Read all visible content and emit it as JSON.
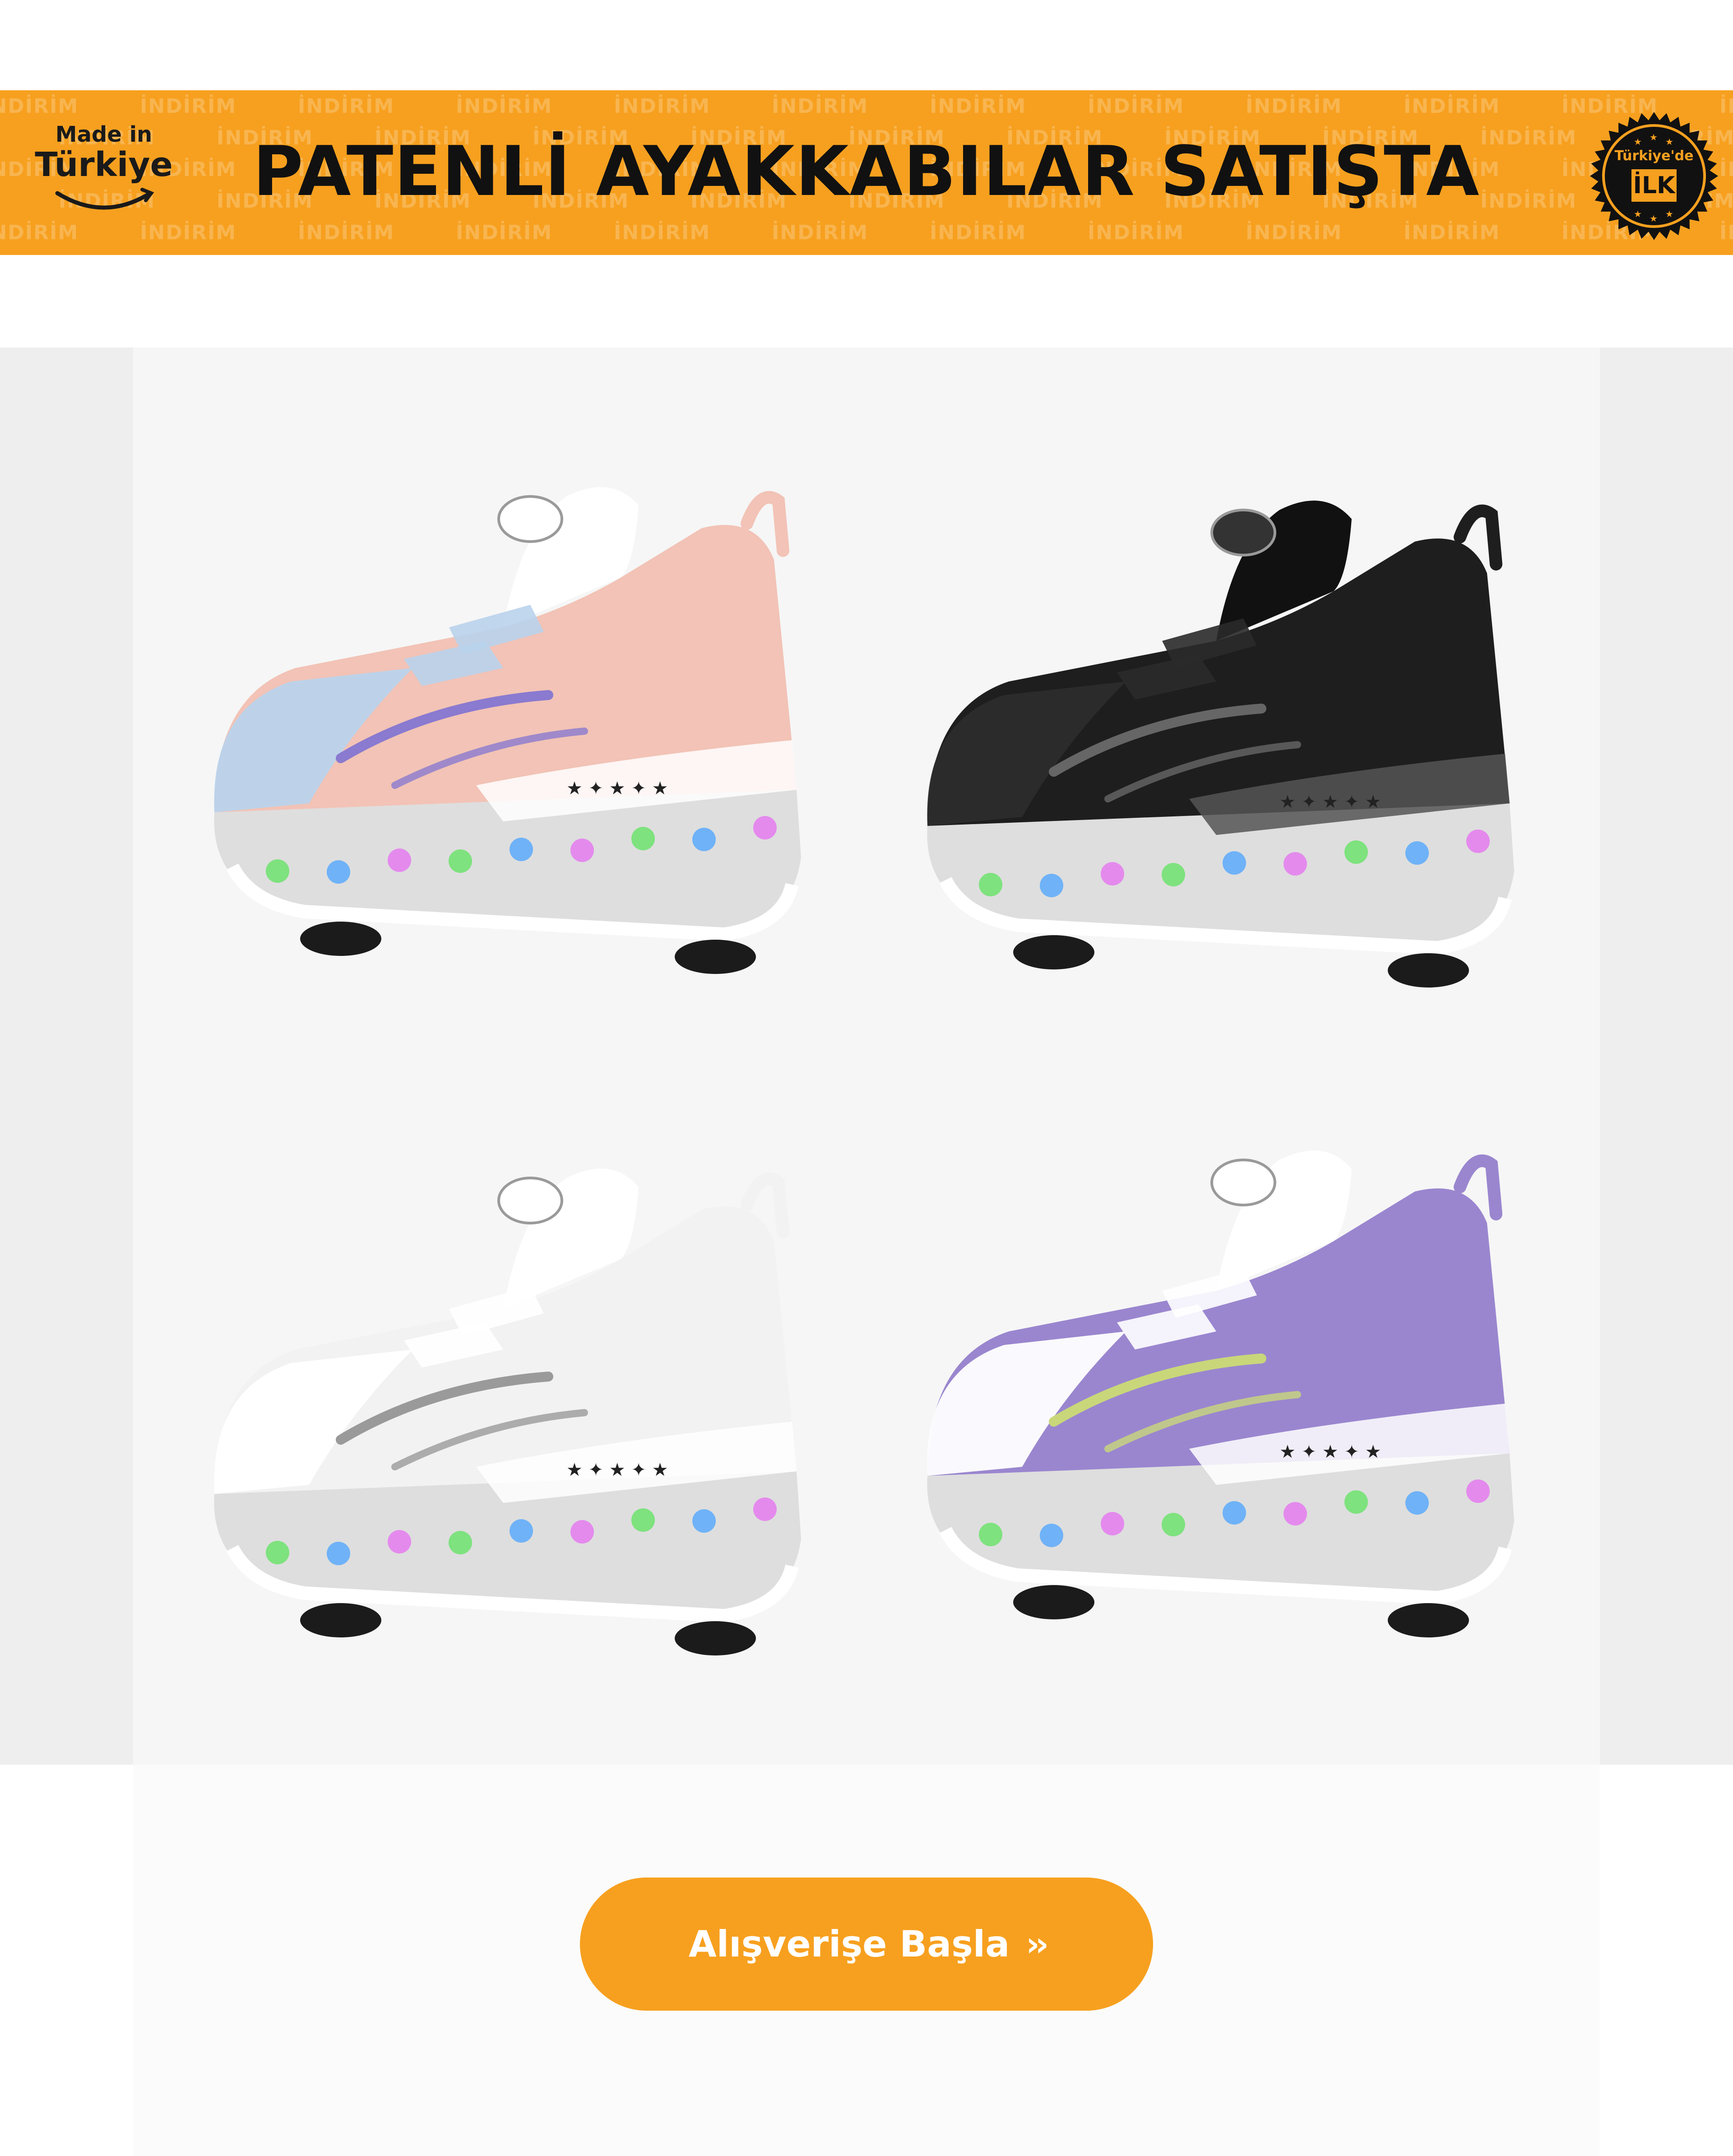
{
  "banner": {
    "pattern_word": "İNDİRİM",
    "made_in_top": "Made in",
    "made_in_country": "Türkiye",
    "title": "PATENLİ AYAKKABILAR SATIŞTA",
    "seal_top": "Türkiye'de",
    "seal_bottom": "İLK",
    "background_color": "#f7a01f"
  },
  "products": [
    {
      "colorway": "pink-blue",
      "upper": "#f2c3b6",
      "accent": "#b9d3ec",
      "stripe": "#8a7ad0"
    },
    {
      "colorway": "black",
      "upper": "#1e1e1e",
      "accent": "#2c2c2c",
      "stripe": "#666666"
    },
    {
      "colorway": "white",
      "upper": "#f2f2f2",
      "accent": "#ffffff",
      "stripe": "#9a9a9a"
    },
    {
      "colorway": "purple",
      "upper": "#9a86cf",
      "accent": "#ffffff",
      "stripe": "#c9d77a"
    }
  ],
  "cta": {
    "label": "Alışverişe Başla",
    "arrow": "››",
    "color": "#f7a01f"
  }
}
